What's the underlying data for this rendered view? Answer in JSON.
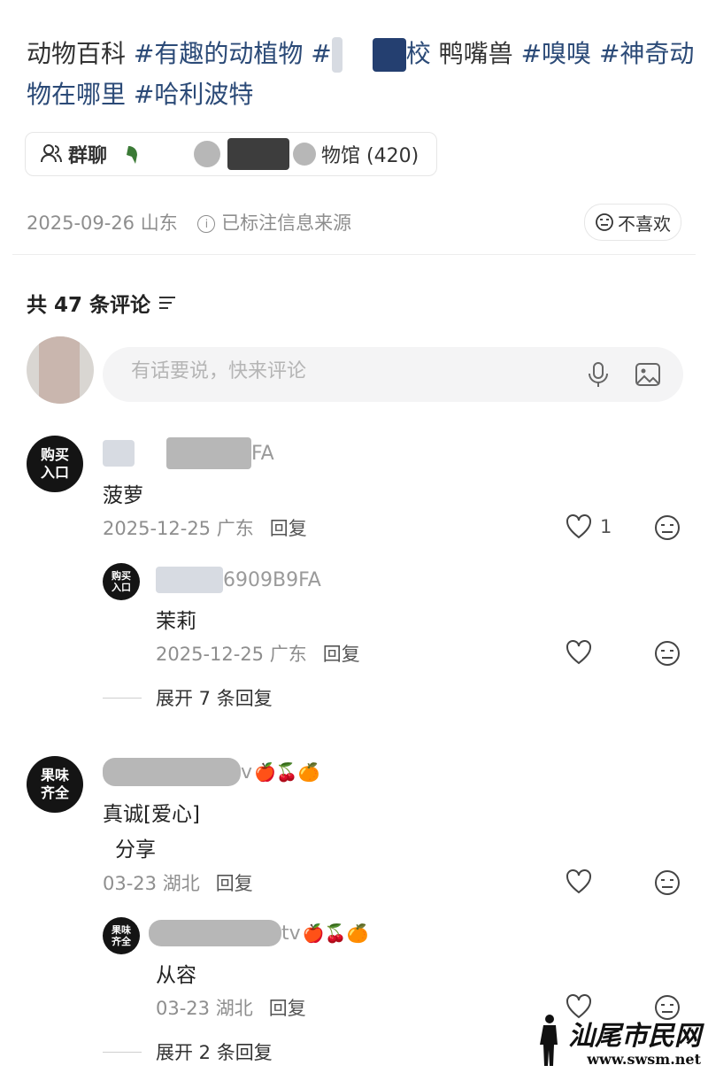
{
  "post": {
    "text_a": "动物百科 ",
    "tag1": "#有趣的动植物",
    "tag2a": " #",
    "tag2b": "校",
    "text_b": " 鸭嘴兽 ",
    "tag3": "#嗅嗅",
    "tag4": "#神奇动物在哪里",
    "tag5": "#哈利波特",
    "group_chat_label": "群聊",
    "group_name_tail": "物馆 (420)",
    "date_location": "2025-09-26 山东",
    "source_note": "已标注信息来源",
    "dislike_label": "不喜欢"
  },
  "comments_header": {
    "count_label": "共 47 条评论"
  },
  "composer": {
    "placeholder": "有话要说，快来评论"
  },
  "comments": [
    {
      "avatar_text": "购买\n入口",
      "username_tail": "FA",
      "text": "菠萝",
      "date_location": "2025-12-25 广东",
      "reply_label": "回复",
      "likes": "1",
      "replies": [
        {
          "avatar_text": "购买\n入口",
          "username_tail": "6909B9FA",
          "text": "茉莉",
          "date_location": "2025-12-25 广东",
          "reply_label": "回复"
        }
      ],
      "expand_label": "展开 7 条回复"
    },
    {
      "avatar_text": "果味\n齐全",
      "username_tail": "v",
      "emojis": "🍎🍒🍊",
      "text_line1": "真诚[爱心]",
      "text_line2": "分享",
      "date_location": "03-23 湖北",
      "reply_label": "回复",
      "replies": [
        {
          "avatar_text": "果味\n齐全",
          "username_tail": "tv",
          "emojis": "🍎🍒🍊",
          "text": "从容",
          "date_location": "03-23 湖北",
          "reply_label": "回复"
        }
      ],
      "expand_label": "展开 2 条回复"
    }
  ],
  "watermark": {
    "title": "汕尾市民网",
    "url": "www.swsm.net"
  },
  "colors": {
    "tag": "#2b4a77",
    "meta": "#8e8e8e",
    "avatar_bg": "#141414"
  }
}
